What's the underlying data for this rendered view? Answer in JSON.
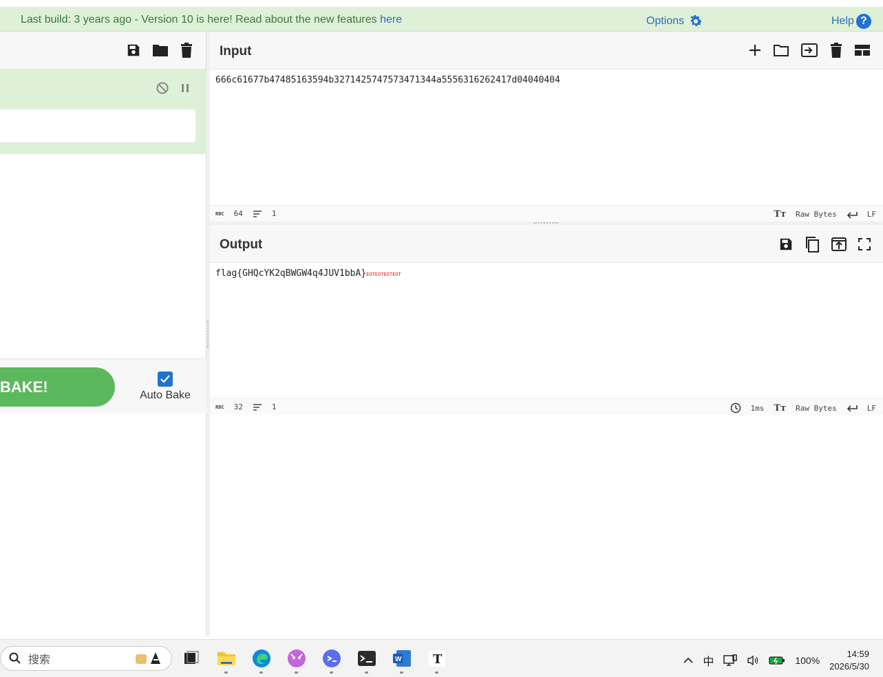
{
  "banner": {
    "message": "Last build: 3 years ago - Version 10 is here! Read about the new features ",
    "link": "here",
    "options_label": "Options",
    "help_label": "Help",
    "help_icon_char": "?"
  },
  "recipe": {
    "bake_label": "BAKE!",
    "auto_bake_label": "Auto Bake",
    "auto_bake_checked": true
  },
  "input": {
    "title": "Input",
    "text": "666c61677b47485163594b3271425747573471344a5556316262417d04040404",
    "status": {
      "length": "64",
      "lines": "1",
      "encoding": "Raw Bytes",
      "eol": "LF",
      "rbc_label": "RBC"
    }
  },
  "output": {
    "title": "Output",
    "text": "flag{GHQcYK2qBWGW4q4JUV1bbA}",
    "trailer": "EOTEOTEOTEOT",
    "status": {
      "length": "32",
      "lines": "1",
      "time": "1ms",
      "encoding": "Raw Bytes",
      "eol": "LF",
      "rbc_label": "RBC"
    }
  },
  "taskbar": {
    "search_placeholder": "搜索",
    "ime": "中",
    "battery": "100%",
    "time": "14:59",
    "date": "2026/5/30",
    "word_letter": "W",
    "typora_letter": "T"
  },
  "colors": {
    "accent_green": "#5cb85c",
    "banner_bg": "#dff0d8",
    "link_blue": "#2a6ebb",
    "eot_red": "#e02020"
  }
}
